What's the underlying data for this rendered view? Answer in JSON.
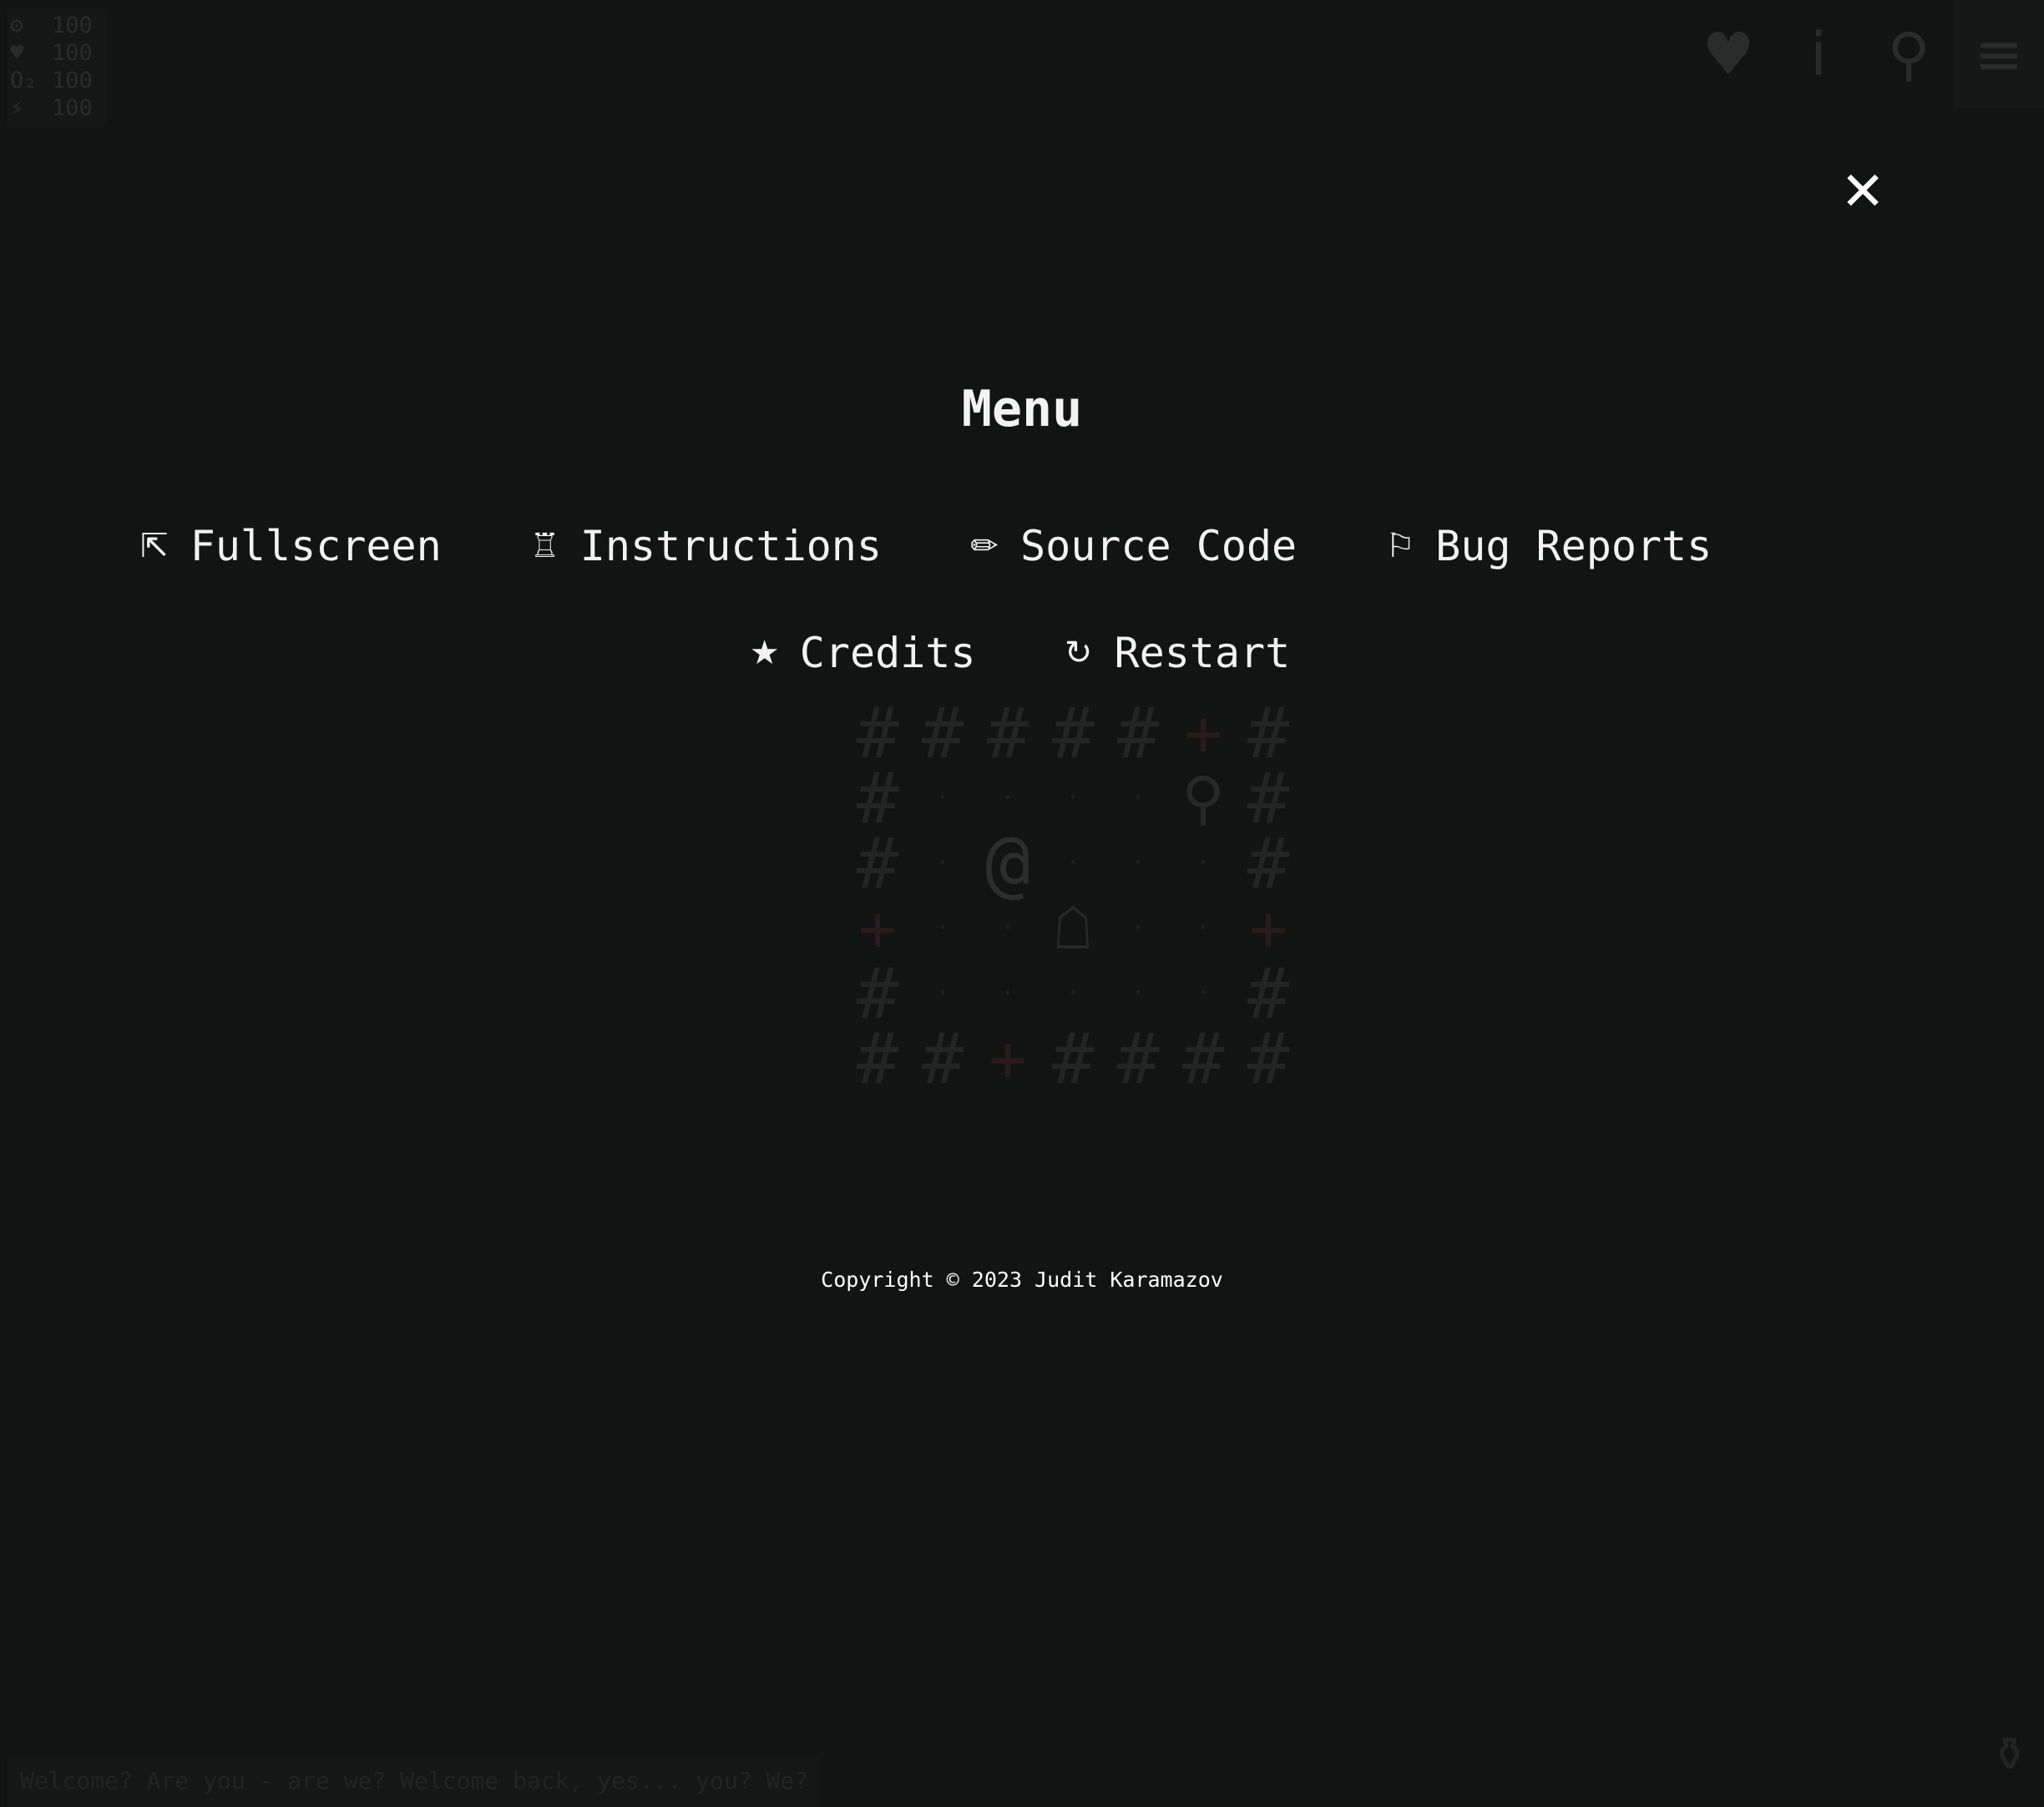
{
  "stats": [
    {
      "icon": "⚙",
      "icon_name": "gear-icon",
      "value": "100"
    },
    {
      "icon": "♥",
      "icon_name": "heart-icon",
      "value": "100"
    },
    {
      "icon": "O₂",
      "icon_name": "oxygen-icon",
      "value": "100"
    },
    {
      "icon": "⚡",
      "icon_name": "energy-icon",
      "value": "100"
    }
  ],
  "topbar": {
    "health_icon": "♥",
    "info_icon": "i",
    "search_icon": "⚲",
    "menu_icon": "≡"
  },
  "map": {
    "rows": [
      [
        "#",
        "#",
        "#",
        "#",
        "#",
        "+",
        "#"
      ],
      [
        "#",
        "·",
        "·",
        "·",
        "·",
        "⚲",
        "#"
      ],
      [
        "#",
        "·",
        "@",
        "·",
        "·",
        "·",
        "#"
      ],
      [
        "+",
        "·",
        "·",
        "☖",
        "·",
        "·",
        "+"
      ],
      [
        "#",
        "·",
        "·",
        "·",
        "·",
        "·",
        "#"
      ],
      [
        "#",
        "#",
        "+",
        "#",
        "#",
        "#",
        "#"
      ]
    ]
  },
  "log": {
    "message": "Welcome? Are you - are we? Welcome back, yes... you? We?"
  },
  "urn_icon": "⚱",
  "menu": {
    "close_icon": "✕",
    "title": "Menu",
    "items_row1": [
      {
        "icon": "⇱",
        "icon_name": "fullscreen-icon",
        "label": "Fullscreen",
        "name": "fullscreen-button"
      },
      {
        "icon": "♖",
        "icon_name": "rook-icon",
        "label": "Instructions",
        "name": "instructions-button"
      },
      {
        "icon": "✏",
        "icon_name": "pencil-icon",
        "label": "Source Code",
        "name": "source-code-button"
      },
      {
        "icon": "⚐",
        "icon_name": "flag-icon",
        "label": "Bug Reports",
        "name": "bug-reports-button"
      }
    ],
    "items_row2": [
      {
        "icon": "★",
        "icon_name": "star-icon",
        "label": "Credits",
        "name": "credits-button"
      },
      {
        "icon": "↻",
        "icon_name": "restart-icon",
        "label": "Restart",
        "name": "restart-button"
      }
    ],
    "copyright": "Copyright © 2023 Judit Karamazov"
  }
}
